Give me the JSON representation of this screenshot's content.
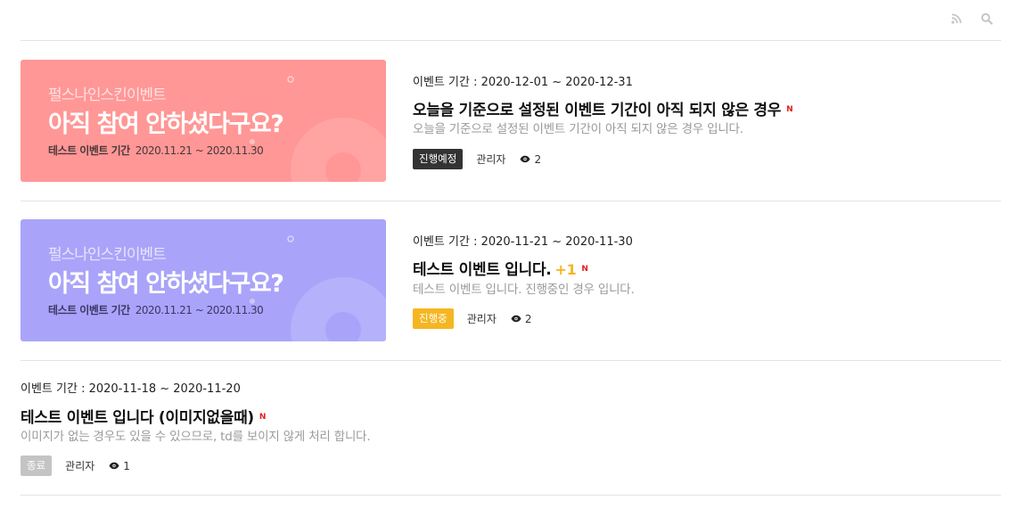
{
  "topbar": {
    "rss_icon": "rss-icon",
    "search_icon": "search-icon"
  },
  "colors": {
    "banner_red": "#ff9796",
    "banner_purple": "#a9a4f9",
    "badge_scheduled": "#333333",
    "badge_ongoing": "#f5b621",
    "badge_ended": "#c4c4c4",
    "new_mark": "#e0201d"
  },
  "events": [
    {
      "banner": {
        "small": "펄스나인스킨이벤트",
        "big": "아직 참여 안하셨다구요?",
        "period_label": "테스트 이벤트 기간",
        "period_dates": "2020.11.21 ~ 2020.11.30"
      },
      "period": "이벤트 기간 : 2020-12-01 ~ 2020-12-31",
      "title": "오늘을 기준으로 설정된 이벤트 기간이 아직 되지 않은 경우",
      "plus": "",
      "new_mark": "N",
      "desc": "오늘을 기준으로 설정된 이벤트 기간이 아직 되지 않은 경우 입니다.",
      "status": "진행예정",
      "author": "관리자",
      "views": "2"
    },
    {
      "banner": {
        "small": "펄스나인스킨이벤트",
        "big": "아직 참여 안하셨다구요?",
        "period_label": "테스트 이벤트 기간",
        "period_dates": "2020.11.21 ~ 2020.11.30"
      },
      "period": "이벤트 기간 : 2020-11-21 ~ 2020-11-30",
      "title": "테스트 이벤트 입니다.",
      "plus": "+1",
      "new_mark": "N",
      "desc": "테스트 이벤트 입니다. 진행중인 경우 입니다.",
      "status": "진행중",
      "author": "관리자",
      "views": "2"
    },
    {
      "period": "이벤트 기간 : 2020-11-18 ~ 2020-11-20",
      "title": "테스트 이벤트 입니다 (이미지없을때)",
      "new_mark": "N",
      "desc": "이미지가 없는 경우도 있을 수 있으므로, td를 보이지 않게 처리 합니다.",
      "status": "종료",
      "author": "관리자",
      "views": "1"
    }
  ]
}
